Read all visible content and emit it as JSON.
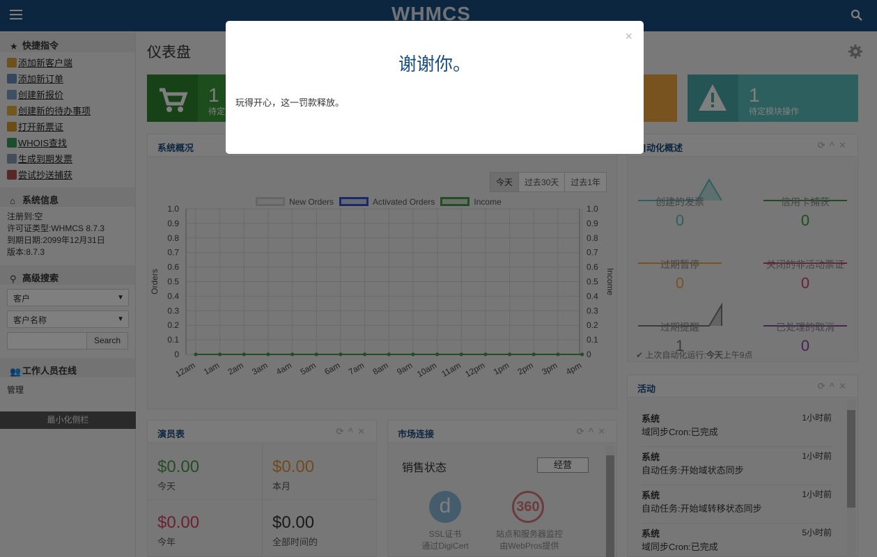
{
  "brand": {
    "logo": "WHMCS"
  },
  "sidebar": {
    "quick_title": "快捷指令",
    "quick_links": [
      "添加新客户端",
      "添加新订单",
      "创建新报价",
      "创建新的待办事项",
      "打开新票证",
      "WHOIS查找",
      "生成到期发票",
      "尝试抄送捕获"
    ],
    "sysinfo_title": "系统信息",
    "sysinfo": [
      "注册到:空",
      "许可证类型:WHMCS 8.7.3",
      "到期日期:2099年12月31日",
      "版本:8.7.3"
    ],
    "adv_title": "高级搜索",
    "select1": "客户",
    "select2": "客户名称",
    "search_btn": "Search",
    "staff_title": "工作人员在线",
    "staff": "管理",
    "minimize": "最小化侧栏"
  },
  "main": {
    "title": "仪表盘",
    "tiles": [
      {
        "num": "1",
        "label": "待定",
        "color": "#3a9a3a"
      },
      {
        "num": "",
        "label": "",
        "color": "#f0a640"
      },
      {
        "num": "1",
        "label": "待定模块操作",
        "color": "#5bbfbf"
      }
    ],
    "overview": {
      "title": "系统概况",
      "ranges": [
        "今天",
        "过去30天",
        "过去1年"
      ]
    },
    "automation": {
      "title": "自动化概述",
      "cells": [
        {
          "label": "创建的发票",
          "value": "0",
          "color": "#5bbfbf"
        },
        {
          "label": "信用卡捕获",
          "value": "0",
          "color": "#3a9a3a"
        },
        {
          "label": "过期暂停",
          "value": "0",
          "color": "#f0a640"
        },
        {
          "label": "关闭的非活动票证",
          "value": "0",
          "color": "#d9416a"
        },
        {
          "label": "过期提醒",
          "value": "1",
          "color": "#777777"
        },
        {
          "label": "已处理的取消",
          "value": "0",
          "color": "#8a4aa0"
        }
      ],
      "last_run_prefix": "上次自动化运行:",
      "last_run_bold": "今天",
      "last_run_suffix": "上午9点"
    },
    "activity": {
      "title": "活动",
      "items": [
        {
          "who": "系统",
          "what": "域同步Cron:已完成",
          "when": "1小时前"
        },
        {
          "who": "系统",
          "what": "自动任务:开始域状态同步",
          "when": "1小时前"
        },
        {
          "who": "系统",
          "what": "自动任务:开始域转移状态同步",
          "when": "1小时前"
        },
        {
          "who": "系统",
          "what": "域同步Cron:已完成",
          "when": "5小时前"
        }
      ]
    },
    "billing": {
      "title": "演员表",
      "today_val": "$0.00",
      "today_lbl": "今天",
      "month_val": "$0.00",
      "month_lbl": "本月",
      "year_val": "$0.00",
      "year_lbl": "今年",
      "all_val": "$0.00",
      "all_lbl": "全部时间的"
    },
    "market": {
      "title": "市场连接",
      "sales_label": "销售状态",
      "manage_btn": "经营",
      "items": [
        {
          "name": "SSL证书",
          "sub": "通过DigiCert"
        },
        {
          "name": "站点和服务器监控",
          "sub": "由WebPros提供"
        }
      ]
    }
  },
  "chart_data": {
    "type": "line",
    "categories": [
      "12am",
      "1am",
      "2am",
      "3am",
      "4am",
      "5am",
      "6am",
      "7am",
      "8am",
      "9am",
      "10am",
      "11am",
      "12pm",
      "1pm",
      "2pm",
      "3pm",
      "4pm"
    ],
    "series": [
      {
        "name": "New Orders",
        "values": [
          0,
          0,
          0,
          0,
          0,
          0,
          0,
          0,
          0,
          0,
          0,
          0,
          0,
          0,
          0,
          0,
          0
        ],
        "color": "#cccccc"
      },
      {
        "name": "Activated Orders",
        "values": [
          0,
          0,
          0,
          0,
          0,
          0,
          0,
          0,
          0,
          0,
          0,
          0,
          0,
          0,
          0,
          0,
          0
        ],
        "color": "#3355cc"
      },
      {
        "name": "Income",
        "values": [
          0,
          0,
          0,
          0,
          0,
          0,
          0,
          0,
          0,
          0,
          0,
          0,
          0,
          0,
          0,
          0,
          0
        ],
        "color": "#4a9a4a"
      }
    ],
    "ylabel": "Orders",
    "y2label": "Income",
    "ylim": [
      0,
      1.0
    ],
    "yticks": [
      "0",
      "0.1",
      "0.2",
      "0.3",
      "0.4",
      "0.5",
      "0.6",
      "0.7",
      "0.8",
      "0.9",
      "1.0"
    ],
    "grid": true,
    "legend": "top"
  },
  "modal": {
    "title": "谢谢你。",
    "message": "玩得开心，这一罚款释放。",
    "close": "×"
  }
}
